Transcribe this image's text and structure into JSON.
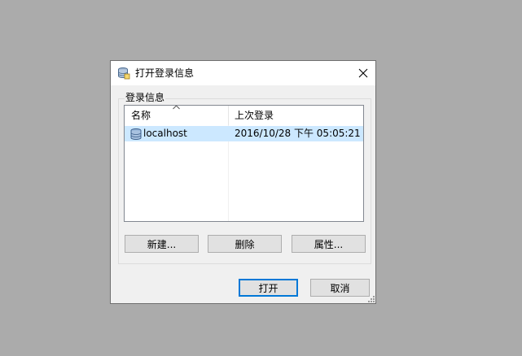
{
  "dialog": {
    "title": "打开登录信息",
    "group_label": "登录信息",
    "columns": [
      "名称",
      "上次登录"
    ],
    "rows": [
      {
        "name": "localhost",
        "last_login": "2016/10/28 下午 05:05:21"
      }
    ],
    "buttons": {
      "new": "新建...",
      "delete": "删除",
      "properties": "属性...",
      "open": "打开",
      "cancel": "取消"
    }
  },
  "colors": {
    "background": "#ababab",
    "dialog": "#f0f0f0",
    "selection": "#cce8ff",
    "default_button_border": "#0078d7"
  }
}
